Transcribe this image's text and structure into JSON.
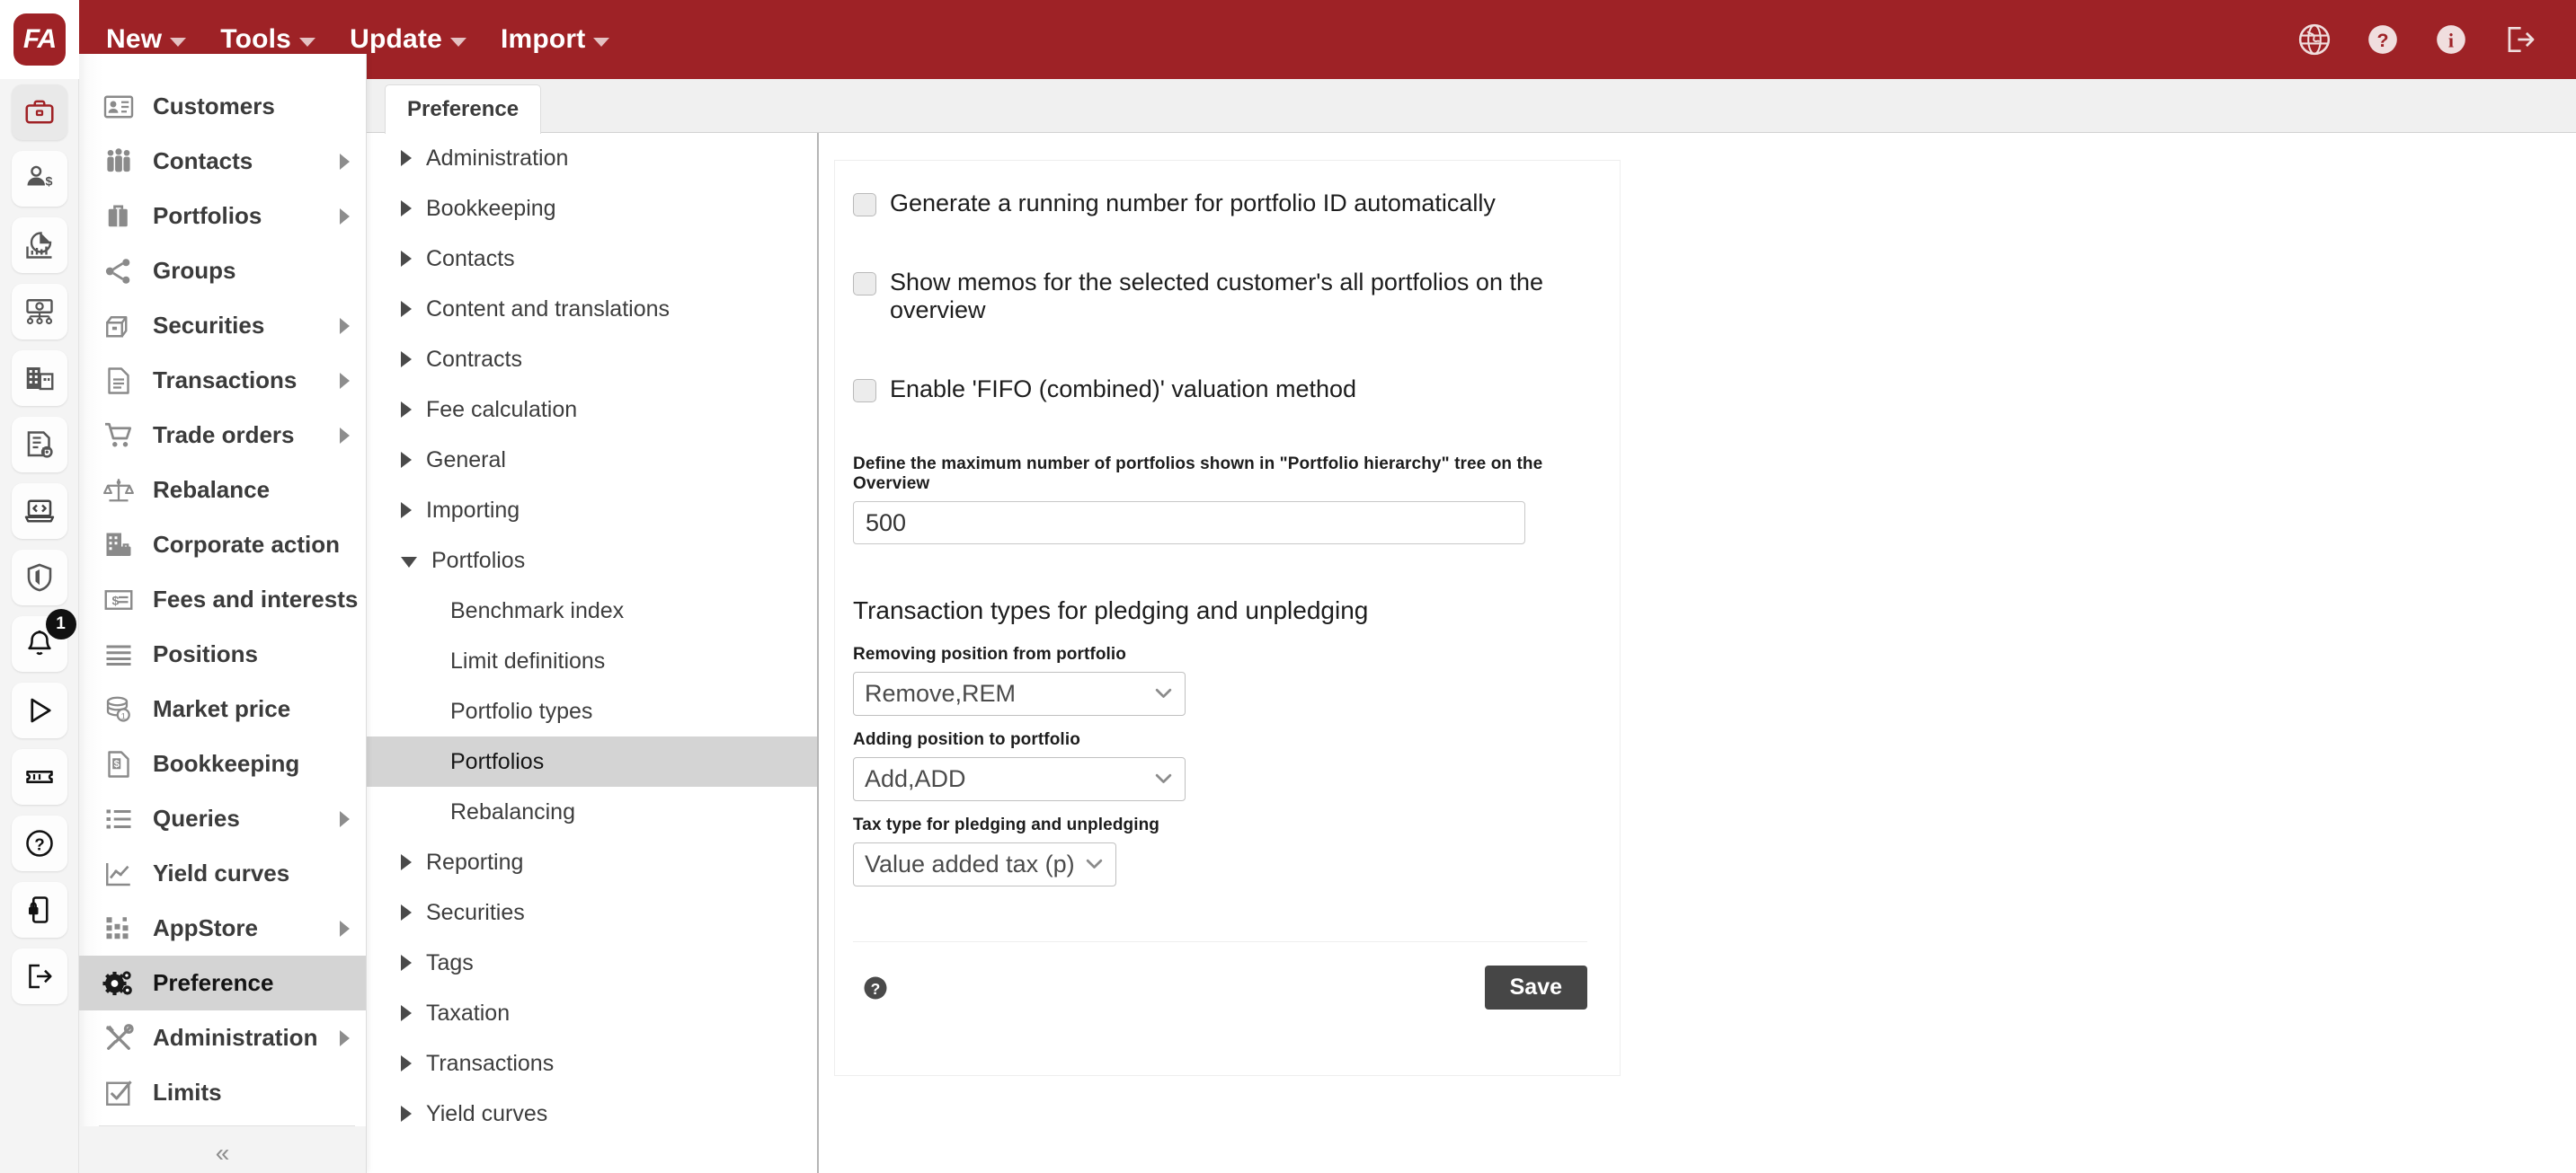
{
  "app": {
    "logo_text": "FA",
    "accent_color": "#9e2226"
  },
  "topbar": {
    "menus": [
      {
        "label": "New",
        "icon": "chevron-down-icon"
      },
      {
        "label": "Tools",
        "icon": "chevron-down-icon"
      },
      {
        "label": "Update",
        "icon": "chevron-down-icon"
      },
      {
        "label": "Import",
        "icon": "chevron-down-icon"
      }
    ],
    "right_icons": [
      {
        "name": "globe-icon"
      },
      {
        "name": "help-circle-icon"
      },
      {
        "name": "info-circle-icon"
      },
      {
        "name": "logout-icon"
      }
    ]
  },
  "rail": {
    "items": [
      {
        "name": "briefcase-icon",
        "active": true
      },
      {
        "name": "customer-money-icon",
        "active": false
      },
      {
        "name": "pie-bar-chart-icon",
        "active": false
      },
      {
        "name": "cash-flow-icon",
        "active": false
      },
      {
        "name": "building-icon",
        "active": false
      },
      {
        "name": "document-gear-icon",
        "active": false
      },
      {
        "name": "laptop-code-icon",
        "active": false
      },
      {
        "name": "shield-icon",
        "active": false
      },
      {
        "name": "bell-icon",
        "active": false,
        "badge": "1"
      },
      {
        "name": "play-icon",
        "active": false
      },
      {
        "name": "ticket-icon",
        "active": false
      },
      {
        "name": "question-circle-icon",
        "active": false
      },
      {
        "name": "mobile-lock-icon",
        "active": false
      },
      {
        "name": "exit-icon",
        "active": false
      }
    ],
    "badge_count": "1"
  },
  "nav": {
    "items": [
      {
        "label": "Customers",
        "icon": "id-card-icon",
        "expandable": false,
        "active": false
      },
      {
        "label": "Contacts",
        "icon": "people-icon",
        "expandable": true,
        "active": false
      },
      {
        "label": "Portfolios",
        "icon": "briefcase-icon",
        "expandable": true,
        "active": false
      },
      {
        "label": "Groups",
        "icon": "share-nodes-icon",
        "expandable": false,
        "active": false
      },
      {
        "label": "Securities",
        "icon": "archive-box-icon",
        "expandable": true,
        "active": false
      },
      {
        "label": "Transactions",
        "icon": "document-lines-icon",
        "expandable": true,
        "active": false
      },
      {
        "label": "Trade orders",
        "icon": "cart-icon",
        "expandable": true,
        "active": false
      },
      {
        "label": "Rebalance",
        "icon": "scales-icon",
        "expandable": false,
        "active": false
      },
      {
        "label": "Corporate action",
        "icon": "building-case-icon",
        "expandable": false,
        "active": false
      },
      {
        "label": "Fees and interests",
        "icon": "invoice-icon",
        "expandable": false,
        "active": false
      },
      {
        "label": "Positions",
        "icon": "lines-icon",
        "expandable": false,
        "active": false
      },
      {
        "label": "Market price",
        "icon": "coins-icon",
        "expandable": false,
        "active": false
      },
      {
        "label": "Bookkeeping",
        "icon": "receipt-icon",
        "expandable": false,
        "active": false
      },
      {
        "label": "Queries",
        "icon": "list-icon",
        "expandable": true,
        "active": false
      },
      {
        "label": "Yield curves",
        "icon": "line-chart-icon",
        "expandable": false,
        "active": false
      },
      {
        "label": "AppStore",
        "icon": "grid-dots-icon",
        "expandable": true,
        "active": false
      },
      {
        "label": "Preference",
        "icon": "gears-icon",
        "expandable": false,
        "active": true
      },
      {
        "label": "Administration",
        "icon": "tools-icon",
        "expandable": true,
        "active": false
      },
      {
        "label": "Limits",
        "icon": "checkbox-icon",
        "expandable": false,
        "active": false
      }
    ],
    "collapse_glyph": "«"
  },
  "tabs": [
    {
      "label": "Preference",
      "active": true
    }
  ],
  "tree": {
    "items": [
      {
        "label": "Administration",
        "level": 0,
        "state": "collapsed",
        "selected": false
      },
      {
        "label": "Bookkeeping",
        "level": 0,
        "state": "collapsed",
        "selected": false
      },
      {
        "label": "Contacts",
        "level": 0,
        "state": "collapsed",
        "selected": false
      },
      {
        "label": "Content and translations",
        "level": 0,
        "state": "collapsed",
        "selected": false
      },
      {
        "label": "Contracts",
        "level": 0,
        "state": "collapsed",
        "selected": false
      },
      {
        "label": "Fee calculation",
        "level": 0,
        "state": "collapsed",
        "selected": false
      },
      {
        "label": "General",
        "level": 0,
        "state": "collapsed",
        "selected": false
      },
      {
        "label": "Importing",
        "level": 0,
        "state": "collapsed",
        "selected": false
      },
      {
        "label": "Portfolios",
        "level": 0,
        "state": "expanded",
        "selected": false
      },
      {
        "label": "Benchmark index",
        "level": 1,
        "state": "leaf",
        "selected": false
      },
      {
        "label": "Limit definitions",
        "level": 1,
        "state": "leaf",
        "selected": false
      },
      {
        "label": "Portfolio types",
        "level": 1,
        "state": "leaf",
        "selected": false
      },
      {
        "label": "Portfolios",
        "level": 1,
        "state": "leaf",
        "selected": true
      },
      {
        "label": "Rebalancing",
        "level": 1,
        "state": "leaf",
        "selected": false
      },
      {
        "label": "Reporting",
        "level": 0,
        "state": "collapsed",
        "selected": false
      },
      {
        "label": "Securities",
        "level": 0,
        "state": "collapsed",
        "selected": false
      },
      {
        "label": "Tags",
        "level": 0,
        "state": "collapsed",
        "selected": false
      },
      {
        "label": "Taxation",
        "level": 0,
        "state": "collapsed",
        "selected": false
      },
      {
        "label": "Transactions",
        "level": 0,
        "state": "collapsed",
        "selected": false
      },
      {
        "label": "Yield curves",
        "level": 0,
        "state": "collapsed",
        "selected": false
      }
    ]
  },
  "form": {
    "checkboxes": [
      {
        "label": "Generate a running number for portfolio ID automatically",
        "checked": false
      },
      {
        "label": "Show memos for the selected customer's all portfolios on the overview",
        "checked": false
      },
      {
        "label": "Enable 'FIFO (combined)' valuation method",
        "checked": false
      }
    ],
    "max_portfolios": {
      "label": "Define the maximum number of portfolios shown in \"Portfolio hierarchy\" tree on the Overview",
      "value": "500"
    },
    "section_title": "Transaction types for pledging and unpledging",
    "selects": [
      {
        "label": "Removing position from portfolio",
        "value": "Remove,REM"
      },
      {
        "label": "Adding position to portfolio",
        "value": "Add,ADD"
      },
      {
        "label": "Tax type for pledging and unpledging",
        "value": "Value added tax (p)"
      }
    ],
    "help_icon": "help-circle-icon",
    "save_label": "Save"
  }
}
